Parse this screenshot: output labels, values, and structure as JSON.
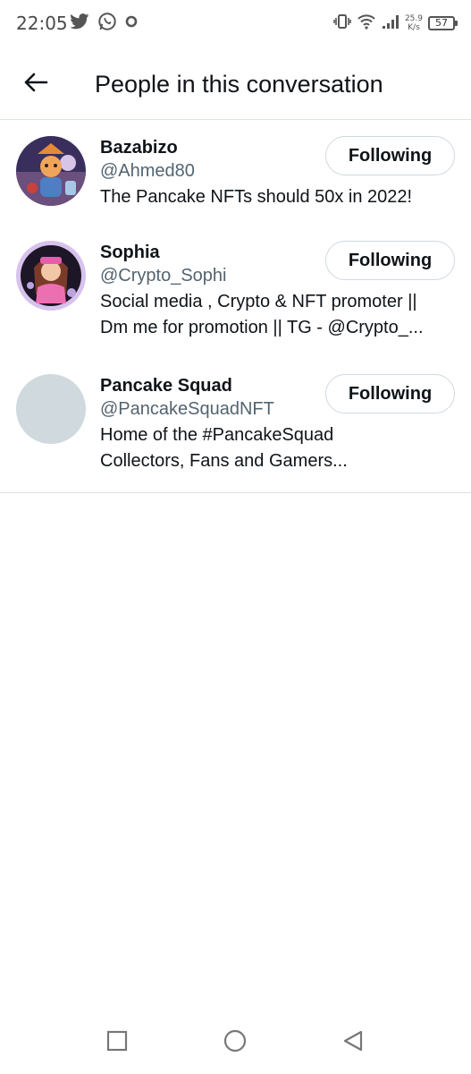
{
  "status_bar": {
    "time": "22:05",
    "net_speed_value": "25.9",
    "net_speed_unit": "K/s",
    "battery": "57",
    "icons": [
      "twitter-icon",
      "whatsapp-icon",
      "record-icon",
      "vibrate-icon",
      "wifi-icon",
      "signal-icon",
      "battery-icon"
    ]
  },
  "header": {
    "back_icon": "arrow-left-icon",
    "title": "People in this conversation"
  },
  "people": [
    {
      "name": "Bazabizo",
      "handle": "@Ahmed80",
      "bio": [
        "The Pancake NFTs should 50x in 2022!"
      ],
      "button": "Following"
    },
    {
      "name": "Sophia",
      "handle": "@Crypto_Sophi",
      "bio": [
        "Social media , Crypto & NFT promoter ||",
        "Dm me for promotion || TG - @Crypto_..."
      ],
      "button": "Following"
    },
    {
      "name": "Pancake Squad",
      "handle": "@PancakeSquadNFT",
      "bio": [
        "Home of the #PancakeSquad",
        "Collectors, Fans and Gamers..."
      ],
      "button": "Following"
    }
  ],
  "nav_bar": {
    "icons": [
      "recents-square-icon",
      "home-circle-icon",
      "back-triangle-icon"
    ]
  },
  "colors": {
    "text": "#0f1419",
    "secondary_text": "#536471",
    "divider": "#dde2e6",
    "button_border": "#cfd9de",
    "placeholder_avatar": "#cfd9de"
  }
}
